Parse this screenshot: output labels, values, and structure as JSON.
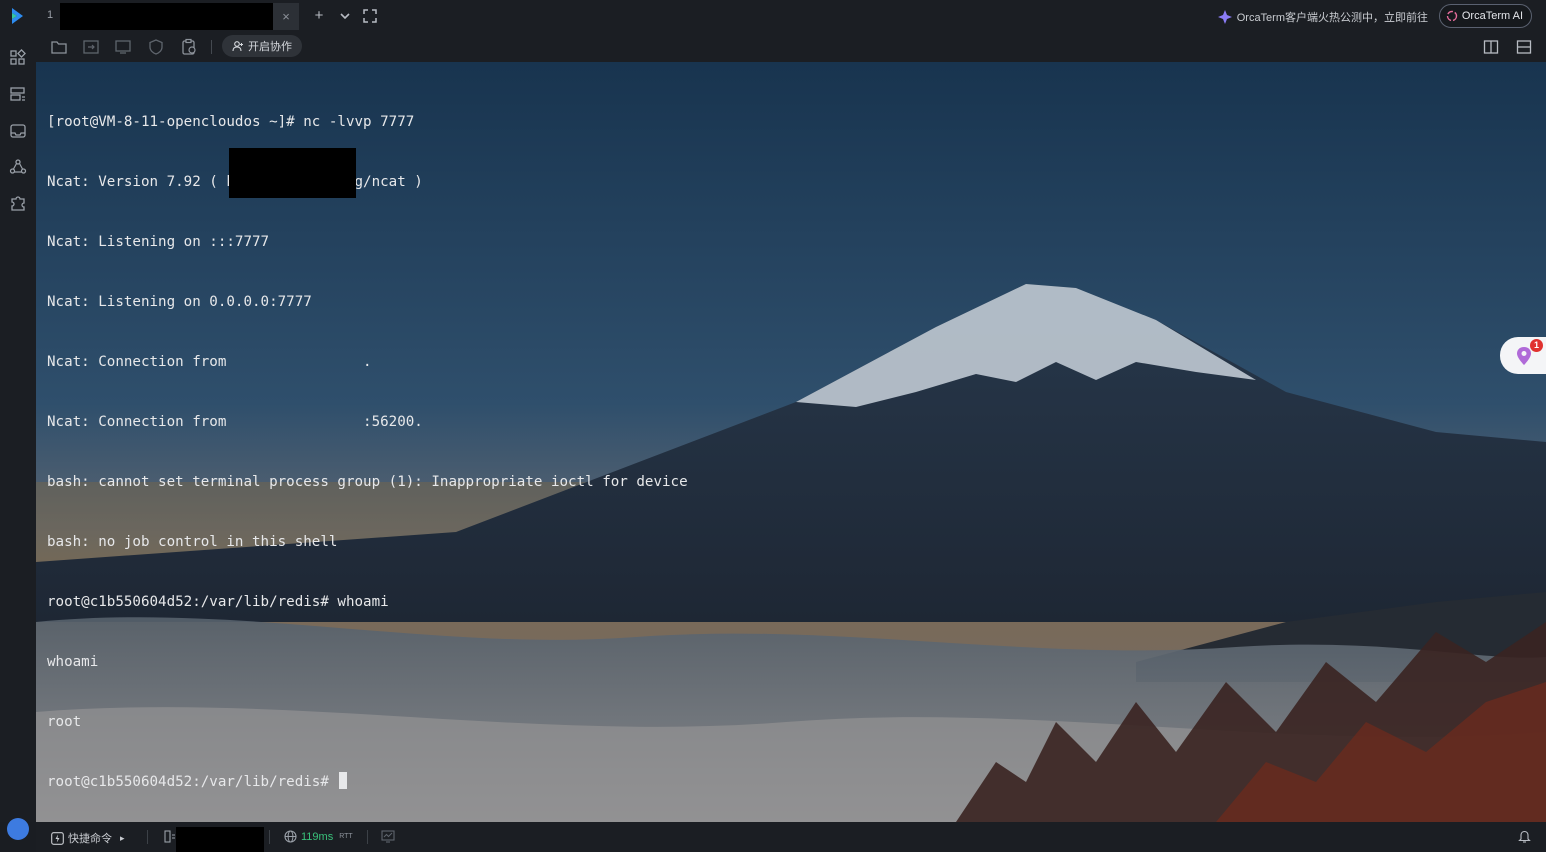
{
  "tabs": {
    "active_index": "1",
    "close_glyph": "×",
    "new_tab_glyph": "+",
    "dropdown_glyph": "⌄",
    "fullscreen_glyph": "⛶"
  },
  "promo": {
    "text": "OrcaTerm客户端火热公测中，立即前往",
    "ai_button": "OrcaTerm AI"
  },
  "toolbar": {
    "collab_label": "开启协作",
    "icons": [
      "folder-icon",
      "file-transfer-icon",
      "monitor-icon",
      "shield-icon",
      "clipboard-icon"
    ]
  },
  "sidebar": {
    "icons": [
      "grid-icon",
      "server-list-icon",
      "inbox-icon",
      "share-icon",
      "puzzle-icon"
    ]
  },
  "terminal": {
    "lines": [
      "[root@VM-8-11-opencloudos ~]# nc -lvvp 7777",
      "Ncat: Version 7.92 ( https://nmap.org/ncat )",
      "Ncat: Listening on :::7777",
      "Ncat: Listening on 0.0.0.0:7777",
      "Ncat: Connection from                .",
      "Ncat: Connection from                :56200.",
      "bash: cannot set terminal process group (1): Inappropriate ioctl for device",
      "bash: no job control in this shell",
      "root@c1b550604d52:/var/lib/redis# whoami",
      "whoami",
      "root",
      "root@c1b550604d52:/var/lib/redis# "
    ]
  },
  "float_widget": {
    "badge_count": "1"
  },
  "statusbar": {
    "quick_commands": "快捷命令",
    "quick_arrow": "▸",
    "latency": "119ms",
    "latency_unit": "RTT"
  },
  "colors": {
    "accent_green": "#39c17a",
    "badge_red": "#e0322f",
    "logo_blue": "#2d8cf0"
  }
}
